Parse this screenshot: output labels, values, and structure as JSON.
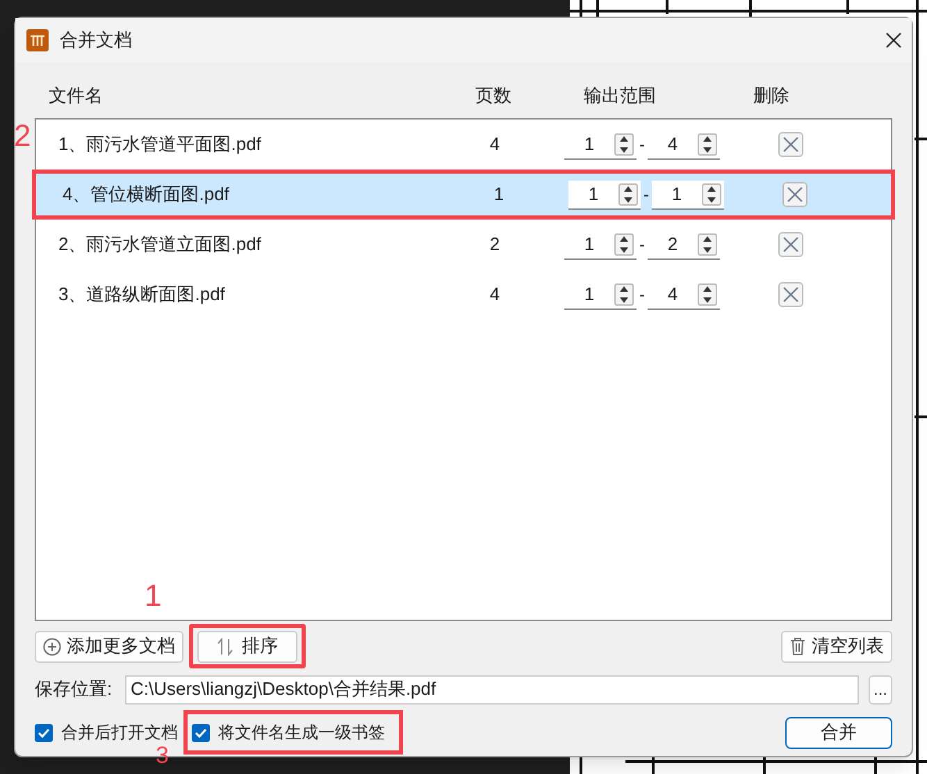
{
  "window": {
    "title": "合并文档"
  },
  "table": {
    "columns": [
      "文件名",
      "页数",
      "输出范围",
      "删除"
    ],
    "rows": [
      {
        "name": "1、雨污水管道平面图.pdf",
        "pages": "4",
        "from": "1",
        "to": "4",
        "selected": false,
        "highlighted": false
      },
      {
        "name": "4、管位横断面图.pdf",
        "pages": "1",
        "from": "1",
        "to": "1",
        "selected": true,
        "highlighted": true
      },
      {
        "name": "2、雨污水管道立面图.pdf",
        "pages": "2",
        "from": "1",
        "to": "2",
        "selected": false,
        "highlighted": false
      },
      {
        "name": "3、道路纵断面图.pdf",
        "pages": "4",
        "from": "1",
        "to": "4",
        "selected": false,
        "highlighted": false
      }
    ],
    "range_separator": "-"
  },
  "buttons": {
    "add": "添加更多文档",
    "sort": {
      "label": "排序",
      "highlighted": true
    },
    "clear": "清空列表"
  },
  "save": {
    "label": "保存位置:",
    "value": "C:\\Users\\liangzj\\Desktop\\合并结果.pdf",
    "browse": "..."
  },
  "options": [
    {
      "label": "合并后打开文档",
      "checked": true,
      "highlighted": false
    },
    {
      "label": "将文件名生成一级书签",
      "checked": true,
      "highlighted": true
    }
  ],
  "merge_button": "合并",
  "annotations": [
    "1",
    "2",
    "3"
  ]
}
